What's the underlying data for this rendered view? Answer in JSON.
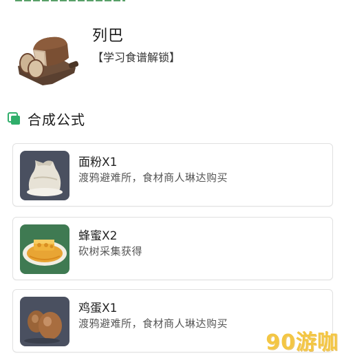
{
  "item": {
    "title": "列巴",
    "subtitle": "【学习食谱解锁】",
    "image_icon": "bread-loaf-icon"
  },
  "section": {
    "title": "合成公式",
    "icon": "overlap-squares-icon",
    "accent": "#2fae6a"
  },
  "ingredients": [
    {
      "name": "面粉X1",
      "desc": "渡鸦避难所，食材商人琳达购买",
      "icon": "flour-sack-icon"
    },
    {
      "name": "蜂蜜X2",
      "desc": "砍树采集获得",
      "icon": "honey-plate-icon"
    },
    {
      "name": "鸡蛋X1",
      "desc": "渡鸦避难所，食材商人琳达购买",
      "icon": "eggs-icon"
    }
  ],
  "watermark": {
    "text": "90游咖",
    "color": "#f3c43a"
  }
}
